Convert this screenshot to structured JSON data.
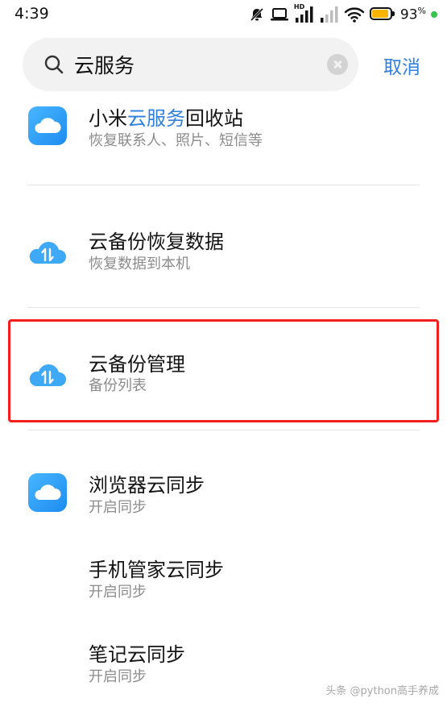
{
  "status_bar": {
    "time": "4:39",
    "network_badge": "HD",
    "battery_percent": "93",
    "battery_level": 0.93,
    "battery_unit": "%"
  },
  "search": {
    "query": "云服务",
    "cancel_label": "取消"
  },
  "results": [
    {
      "title_before": "小米",
      "title_highlight": "云服务",
      "title_after": "回收站",
      "subtitle": "恢复联系人、照片、短信等",
      "icon": "blue-cloud-app-icon"
    },
    {
      "title": "云备份恢复数据",
      "subtitle": "恢复数据到本机",
      "icon": "cloud-sync-icon"
    },
    {
      "title": "云备份管理",
      "subtitle": "备份列表",
      "icon": "cloud-sync-icon"
    },
    {
      "title": "浏览器云同步",
      "subtitle": "开启同步",
      "icon": "blue-cloud-app-icon"
    },
    {
      "title": "手机管家云同步",
      "subtitle": "开启同步"
    },
    {
      "title": "笔记云同步",
      "subtitle": "开启同步"
    }
  ],
  "watermark": "头条 @python高手养成",
  "colors": {
    "accent": "#2f7fe0",
    "highlight_box": "#f31e1e",
    "battery": "#f7b500",
    "charging": "#37c24a"
  }
}
